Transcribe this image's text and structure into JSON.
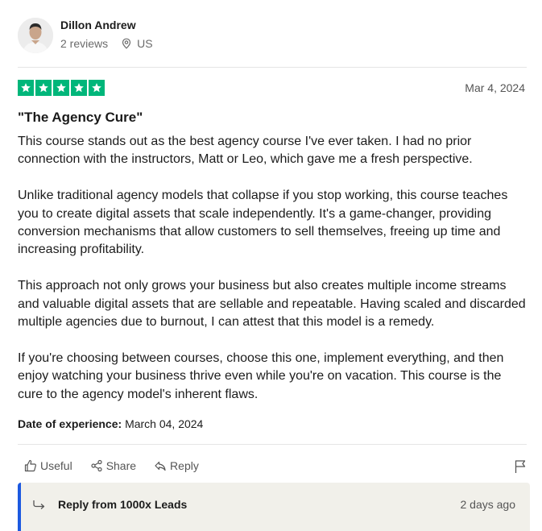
{
  "user": {
    "name": "Dillon Andrew",
    "reviews": "2 reviews",
    "location": "US"
  },
  "rating": {
    "stars": 5,
    "max": 5,
    "color": "#00b67a"
  },
  "review": {
    "date": "Mar 4, 2024",
    "title": "\"The Agency Cure\"",
    "paragraphs": [
      "This course stands out as the best agency course I've ever taken. I had no prior connection with the instructors, Matt or Leo, which gave me a fresh perspective.",
      "Unlike traditional agency models that collapse if you stop working, this course teaches you to create digital assets that scale independently. It's a game-changer, providing conversion mechanisms that allow customers to sell themselves, freeing up time and increasing profitability.",
      "This approach not only grows your business but also creates multiple income streams and valuable digital assets that are sellable and repeatable. Having scaled and discarded multiple agencies due to burnout, I can attest that this model is a remedy.",
      "If you're choosing between courses, choose this one, implement everything, and then enjoy watching your business thrive even while you're on vacation. This course is the cure to the agency model's inherent flaws."
    ],
    "experience_label": "Date of experience:",
    "experience_date": "March 04, 2024"
  },
  "actions": {
    "useful": "Useful",
    "share": "Share",
    "reply": "Reply"
  },
  "company_reply": {
    "title": "Reply from 1000x Leads",
    "time": "2 days ago",
    "accent": "#1c59e0"
  },
  "icons": {
    "location": "location-pin-icon",
    "star": "star-icon",
    "useful": "thumbs-up-icon",
    "share": "share-icon",
    "reply": "reply-icon",
    "flag": "flag-icon"
  }
}
